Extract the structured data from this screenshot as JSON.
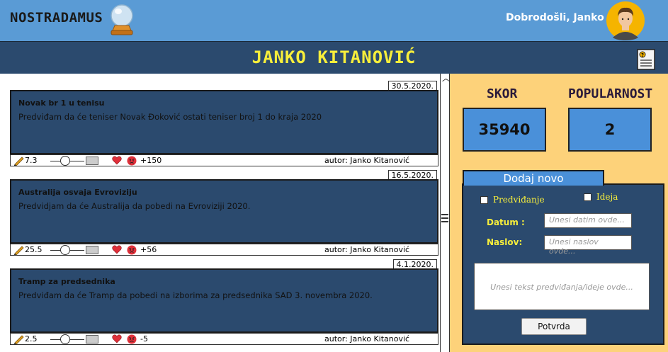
{
  "header": {
    "logo": "NOSTRADAMUS",
    "welcome": "Dobrodošli, Janko",
    "page_title": "JANKO KITANOVIĆ"
  },
  "posts": [
    {
      "date": "30.5.2020.",
      "title": "Novak br 1 u tenisu",
      "text": "Predviđam da će teniser Novak Đoković ostati teniser broj 1 do kraja 2020",
      "rating": "7.3",
      "score": "+150",
      "author": "autor: Janko Kitanović"
    },
    {
      "date": "16.5.2020.",
      "title": "Australija osvaja Evroviziju",
      "text": "Predvidjam da će Australija da pobedi na Evroviziji 2020.",
      "rating": "25.5",
      "score": "+56",
      "author": "autor: Janko Kitanović"
    },
    {
      "date": "4.1.2020.",
      "title": "Tramp za predsednika",
      "text": "Predviđam da će Tramp da pobedi na izborima za predsednika SAD 3. novembra 2020.",
      "rating": "2.5",
      "score": "-5",
      "author": "autor: Janko Kitanović"
    }
  ],
  "stats": {
    "skor_label": "SKOR",
    "skor_value": "35940",
    "popularnost_label": "POPULARNOST",
    "popularnost_value": "2"
  },
  "add_form": {
    "tab_label": "Dodaj novo",
    "type_prediction": "Predviđanje",
    "type_idea": "Ideja",
    "date_label": "Datum :",
    "date_placeholder": "Unesi datim ovde...",
    "title_label": "Naslov:",
    "title_placeholder": "Unesi naslov ovde...",
    "text_placeholder": "Unesi tekst predviđanja/ideje ovde...",
    "confirm_label": "Potvrda"
  },
  "colors": {
    "topbar": "#5a9bd5",
    "titlebar": "#2b4a6e",
    "title_text": "#f7ee3b",
    "sidebar": "#fdd27a",
    "stat_box": "#4a90d9"
  },
  "icons": [
    "crystal-ball-icon",
    "avatar-icon",
    "document-icon",
    "pencil-icon",
    "heart-icon",
    "angry-face-icon"
  ]
}
